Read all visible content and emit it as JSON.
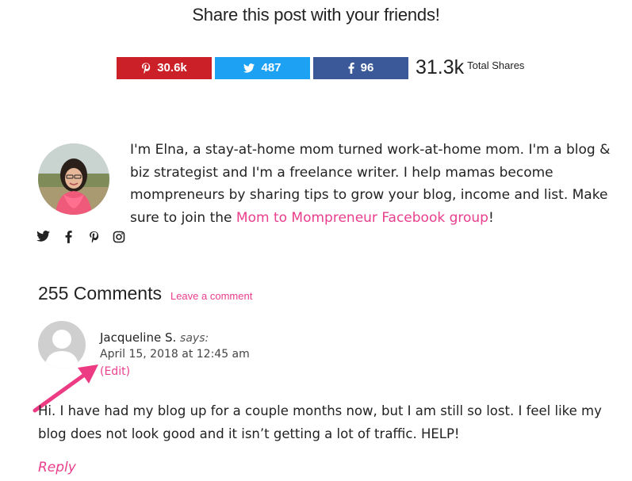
{
  "share": {
    "title": "Share this post with your friends!",
    "pinterest": {
      "count": "30.6k",
      "icon": "pinterest-icon",
      "color": "#cb2027"
    },
    "twitter": {
      "count": "487",
      "icon": "twitter-icon",
      "color": "#1da1f2"
    },
    "facebook": {
      "count": "96",
      "icon": "facebook-icon",
      "color": "#3b5998"
    },
    "total_count": "31.3k",
    "total_label": "Total Shares"
  },
  "author": {
    "bio_text": "I'm Elna, a stay-at-home mom turned work-at-home mom. I'm a blog & biz strategist and I'm a freelance writer. I help mamas become mompreneurs by sharing tips to grow your blog, income and list. Make sure to join the ",
    "bio_link": "Mom to Mompreneur Facebook group",
    "bio_end": "!",
    "social_icons": [
      "twitter-icon",
      "facebook-icon",
      "pinterest-icon",
      "instagram-icon"
    ]
  },
  "comments": {
    "count_label": "255 Comments",
    "leave_comment": "Leave a comment",
    "items": [
      {
        "author": "Jacqueline S.",
        "says": "says:",
        "date": "April 15, 2018 at 12:45 am",
        "edit": "(Edit)",
        "text": "Hi. I have had my blog up for a couple months now, but I am still so lost. I feel like my blog does not look good and it isn’t getting a lot of traffic. HELP!",
        "reply": "Reply"
      }
    ]
  },
  "colors": {
    "accent": "#e83e8c",
    "annotation_arrow": "#ec3b83"
  }
}
